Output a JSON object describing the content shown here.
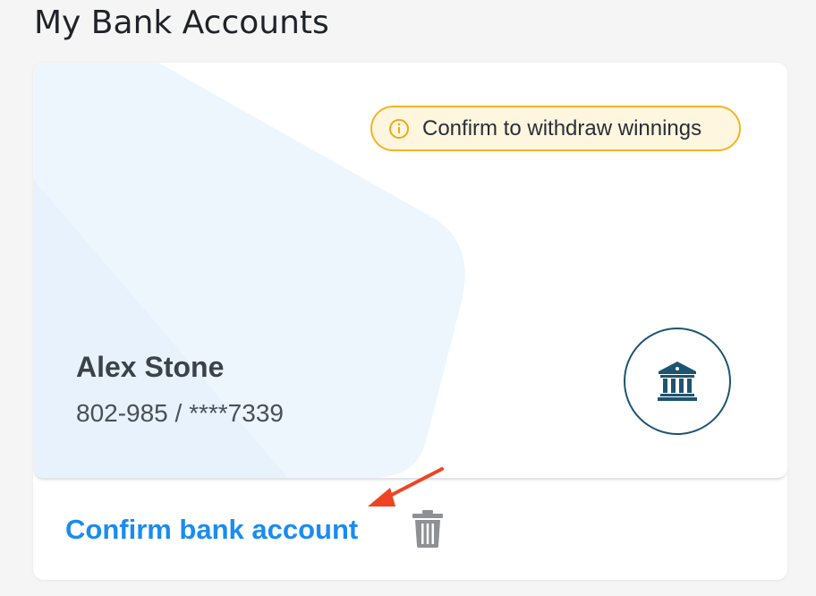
{
  "header": {
    "title": "My Bank Accounts"
  },
  "account_card": {
    "warning_badge": "Confirm to withdraw winnings",
    "holder_name": "Alex Stone",
    "account_number": "802-985 / ****7339",
    "bank_icon": "bank-icon"
  },
  "footer": {
    "confirm_label": "Confirm bank account",
    "delete_icon": "trash-icon"
  },
  "annotation": {
    "arrow_icon": "red-arrow-icon"
  },
  "colors": {
    "link": "#1a8cf0",
    "warning_border": "#f5b324",
    "warning_bg": "#fff6df",
    "bank_icon": "#1d5470",
    "arrow": "#ee4422",
    "trash": "#8e9094"
  }
}
